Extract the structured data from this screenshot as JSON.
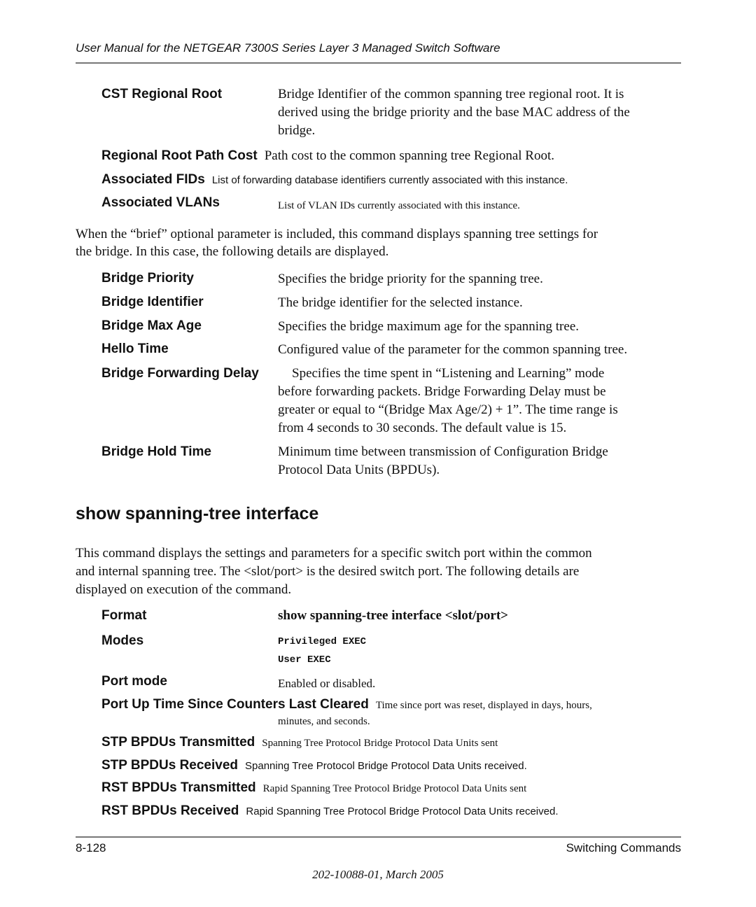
{
  "header": {
    "title": "User Manual for the NETGEAR 7300S Series Layer 3 Managed Switch Software"
  },
  "fields_top": {
    "cst_regional_root": {
      "term": "CST Regional Root",
      "lines": [
        "Bridge Identifier of the common spanning tree regional root. It is",
        "derived using the bridge priority and the base MAC address of the",
        "bridge."
      ]
    },
    "regional_root_path_cost": {
      "term": "Regional Root Path Cost",
      "desc": "Path cost to the common spanning tree Regional Root."
    },
    "associated_fids": {
      "term": "Associated FIDs",
      "desc": "List of forwarding database identifiers currently associated with this instance."
    },
    "associated_vlans": {
      "term": "Associated VLANs",
      "desc": "List of VLAN IDs currently associated with this instance."
    }
  },
  "brief_paragraph": {
    "lines": [
      "When the “brief” optional parameter is included, this command displays spanning tree settings for",
      "the bridge. In this case, the following details are displayed."
    ]
  },
  "brief_fields": {
    "bridge_priority": {
      "term": "Bridge Priority",
      "desc": "Specifies the bridge priority for the spanning tree."
    },
    "bridge_identifier": {
      "term": "Bridge Identifier",
      "desc": "The bridge identifier for the selected instance."
    },
    "bridge_max_age": {
      "term": "Bridge Max Age",
      "desc": "Specifies the bridge maximum age for the spanning tree."
    },
    "hello_time": {
      "term": "Hello Time",
      "desc": "Configured value of the parameter for the common spanning tree."
    },
    "bridge_forwarding_delay": {
      "term": "Bridge Forwarding Delay",
      "lines": [
        "Specifies the time spent in “Listening and Learning” mode",
        "before forwarding packets. Bridge Forwarding Delay must be",
        "greater or equal to “(Bridge Max Age/2) + 1”. The time range is",
        "from 4 seconds to 30 seconds. The default value is 15."
      ]
    },
    "bridge_hold_time": {
      "term": "Bridge Hold Time",
      "lines": [
        "Minimum time between transmission of Configuration Bridge",
        "Protocol Data Units (BPDUs)."
      ]
    }
  },
  "section": {
    "heading": "show spanning-tree interface",
    "intro_lines": [
      "This command displays the settings and parameters for a specific switch port within the common",
      "and internal spanning tree. The <slot/port> is the desired switch port. The following details are",
      "displayed on execution of the command."
    ],
    "format": {
      "term": "Format",
      "value": "show spanning-tree interface <slot/port>"
    },
    "modes": {
      "term": "Modes",
      "values": [
        "Privileged EXEC",
        "User EXEC"
      ]
    },
    "port_mode": {
      "term": "Port mode",
      "desc": "Enabled or disabled."
    },
    "port_up_time": {
      "term": "Port Up Time Since Counters Last Cleared",
      "desc": "Time since port was reset, displayed in days, hours,",
      "desc2": "minutes, and seconds."
    },
    "stp_tx": {
      "term": "STP BPDUs Transmitted",
      "desc": "Spanning Tree Protocol Bridge Protocol Data Units sent"
    },
    "stp_rx": {
      "term": "STP BPDUs Received",
      "desc": "Spanning Tree Protocol Bridge Protocol Data Units received."
    },
    "rst_tx": {
      "term": "RST BPDUs Transmitted",
      "desc": "Rapid Spanning Tree Protocol Bridge Protocol Data Units sent"
    },
    "rst_rx": {
      "term": "RST BPDUs Received",
      "desc": "Rapid Spanning Tree Protocol Bridge Protocol Data Units received."
    }
  },
  "footer": {
    "page_number": "8-128",
    "section_name": "Switching Commands",
    "doc_id": "202-10088-01, March 2005"
  }
}
